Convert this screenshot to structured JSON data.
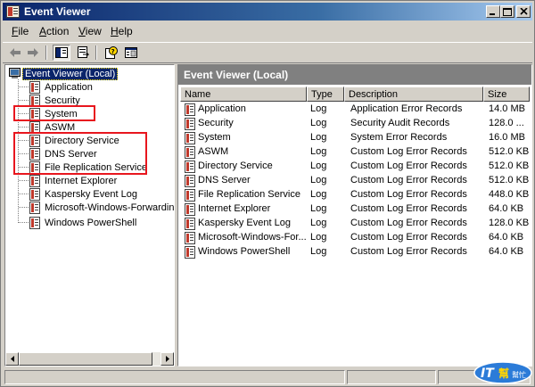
{
  "window": {
    "title": "Event Viewer"
  },
  "menu": [
    {
      "label": "File",
      "accel": "F",
      "rest": "ile"
    },
    {
      "label": "Action",
      "accel": "A",
      "rest": "ction"
    },
    {
      "label": "View",
      "accel": "V",
      "rest": "iew"
    },
    {
      "label": "Help",
      "accel": "H",
      "rest": "elp"
    }
  ],
  "toolbar": {
    "buttons": [
      "back-icon",
      "forward-icon",
      "show-hide-console-tree-icon",
      "export-list-icon",
      "help-icon",
      "properties-icon"
    ],
    "pressed": "show-hide-console-tree-icon"
  },
  "tree": {
    "root": "Event Viewer (Local)",
    "items": [
      "Application",
      "Security",
      "System",
      "ASWM",
      "Directory Service",
      "DNS Server",
      "File Replication Service",
      "Internet Explorer",
      "Kaspersky Event Log",
      "Microsoft-Windows-Forwarding/",
      "Windows PowerShell"
    ]
  },
  "list": {
    "title": "Event Viewer (Local)",
    "columns": [
      "Name",
      "Type",
      "Description",
      "Size"
    ],
    "rows": [
      {
        "name": "Application",
        "type": "Log",
        "description": "Application Error Records",
        "size": "14.0 MB"
      },
      {
        "name": "Security",
        "type": "Log",
        "description": "Security Audit Records",
        "size": "128.0 ..."
      },
      {
        "name": "System",
        "type": "Log",
        "description": "System Error Records",
        "size": "16.0 MB"
      },
      {
        "name": "ASWM",
        "type": "Log",
        "description": "Custom Log Error Records",
        "size": "512.0 KB"
      },
      {
        "name": "Directory Service",
        "type": "Log",
        "description": "Custom Log Error Records",
        "size": "512.0 KB"
      },
      {
        "name": "DNS Server",
        "type": "Log",
        "description": "Custom Log Error Records",
        "size": "512.0 KB"
      },
      {
        "name": "File Replication Service",
        "type": "Log",
        "description": "Custom Log Error Records",
        "size": "448.0 KB"
      },
      {
        "name": "Internet Explorer",
        "type": "Log",
        "description": "Custom Log Error Records",
        "size": "64.0 KB"
      },
      {
        "name": "Kaspersky Event Log",
        "type": "Log",
        "description": "Custom Log Error Records",
        "size": "128.0 KB"
      },
      {
        "name": "Microsoft-Windows-For...",
        "type": "Log",
        "description": "Custom Log Error Records",
        "size": "64.0 KB"
      },
      {
        "name": "Windows PowerShell",
        "type": "Log",
        "description": "Custom Log Error Records",
        "size": "64.0 KB"
      }
    ]
  },
  "watermark": {
    "main": "IT",
    "sub": "幫",
    "sub2": "幫忙"
  },
  "colors": {
    "title_start": "#0a246a",
    "title_end": "#a6caf0",
    "highlight_box": "#e8161e",
    "selection": "#0a246a"
  }
}
